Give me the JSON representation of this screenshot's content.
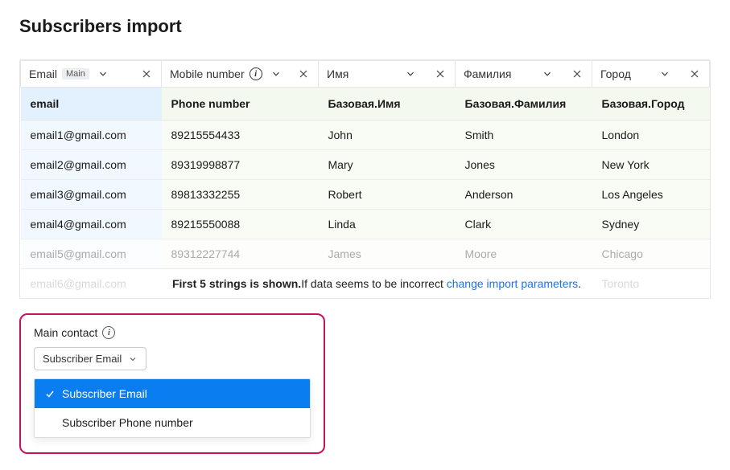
{
  "title": "Subscribers import",
  "columns": [
    {
      "label": "Email",
      "badge": "Main",
      "has_info": false,
      "field": "email"
    },
    {
      "label": "Mobile number",
      "badge": null,
      "has_info": true,
      "field": "Phone number"
    },
    {
      "label": "Имя",
      "badge": null,
      "has_info": false,
      "field": "Базовая.Имя"
    },
    {
      "label": "Фамилия",
      "badge": null,
      "has_info": false,
      "field": "Базовая.Фамилия"
    },
    {
      "label": "Город",
      "badge": null,
      "has_info": false,
      "field": "Базовая.Город"
    }
  ],
  "rows": [
    {
      "email": "email1@gmail.com",
      "phone": "89215554433",
      "fname": "John",
      "lname": "Smith",
      "city": "London"
    },
    {
      "email": "email2@gmail.com",
      "phone": "89319998877",
      "fname": "Mary",
      "lname": "Jones",
      "city": "New York"
    },
    {
      "email": "email3@gmail.com",
      "phone": "89813332255",
      "fname": "Robert",
      "lname": "Anderson",
      "city": "Los Angeles"
    },
    {
      "email": "email4@gmail.com",
      "phone": "89215550088",
      "fname": "Linda",
      "lname": "Clark",
      "city": "Sydney"
    },
    {
      "email": "email5@gmail.com",
      "phone": "89312227744",
      "fname": "James",
      "lname": "Moore",
      "city": "Chicago"
    },
    {
      "email": "email6@gmail.com",
      "phone": "",
      "fname": "",
      "lname": "",
      "city": "Toronto"
    }
  ],
  "footer": {
    "bold": "First 5 strings is shown.",
    "plain": "If data seems to be incorrect ",
    "link": "change import parameters",
    "tail": "."
  },
  "panel": {
    "title": "Main contact",
    "selected": "Subscriber Email",
    "options": [
      "Subscriber Email",
      "Subscriber Phone number"
    ]
  }
}
